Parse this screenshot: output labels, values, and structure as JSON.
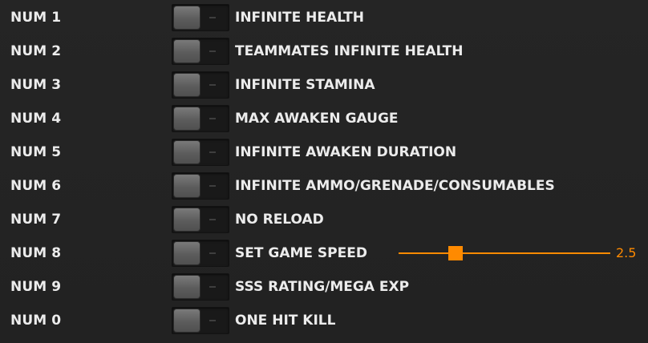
{
  "accent_color": "#ff8a00",
  "options": [
    {
      "hotkey": "NUM 1",
      "label": "INFINITE HEALTH",
      "enabled": false
    },
    {
      "hotkey": "NUM 2",
      "label": "TEAMMATES INFINITE HEALTH",
      "enabled": false
    },
    {
      "hotkey": "NUM 3",
      "label": "INFINITE STAMINA",
      "enabled": false
    },
    {
      "hotkey": "NUM 4",
      "label": "MAX AWAKEN GAUGE",
      "enabled": false
    },
    {
      "hotkey": "NUM 5",
      "label": "INFINITE AWAKEN DURATION",
      "enabled": false
    },
    {
      "hotkey": "NUM 6",
      "label": "INFINITE AMMO/GRENADE/CONSUMABLES",
      "enabled": false
    },
    {
      "hotkey": "NUM 7",
      "label": "NO RELOAD",
      "enabled": false
    },
    {
      "hotkey": "NUM 8",
      "label": "SET GAME SPEED",
      "enabled": false
    },
    {
      "hotkey": "NUM 9",
      "label": "SSS RATING/MEGA EXP",
      "enabled": false
    },
    {
      "hotkey": "NUM 0",
      "label": "ONE HIT KILL",
      "enabled": false
    }
  ],
  "game_speed": {
    "value_text": "2.5",
    "position_fraction": 0.27
  }
}
